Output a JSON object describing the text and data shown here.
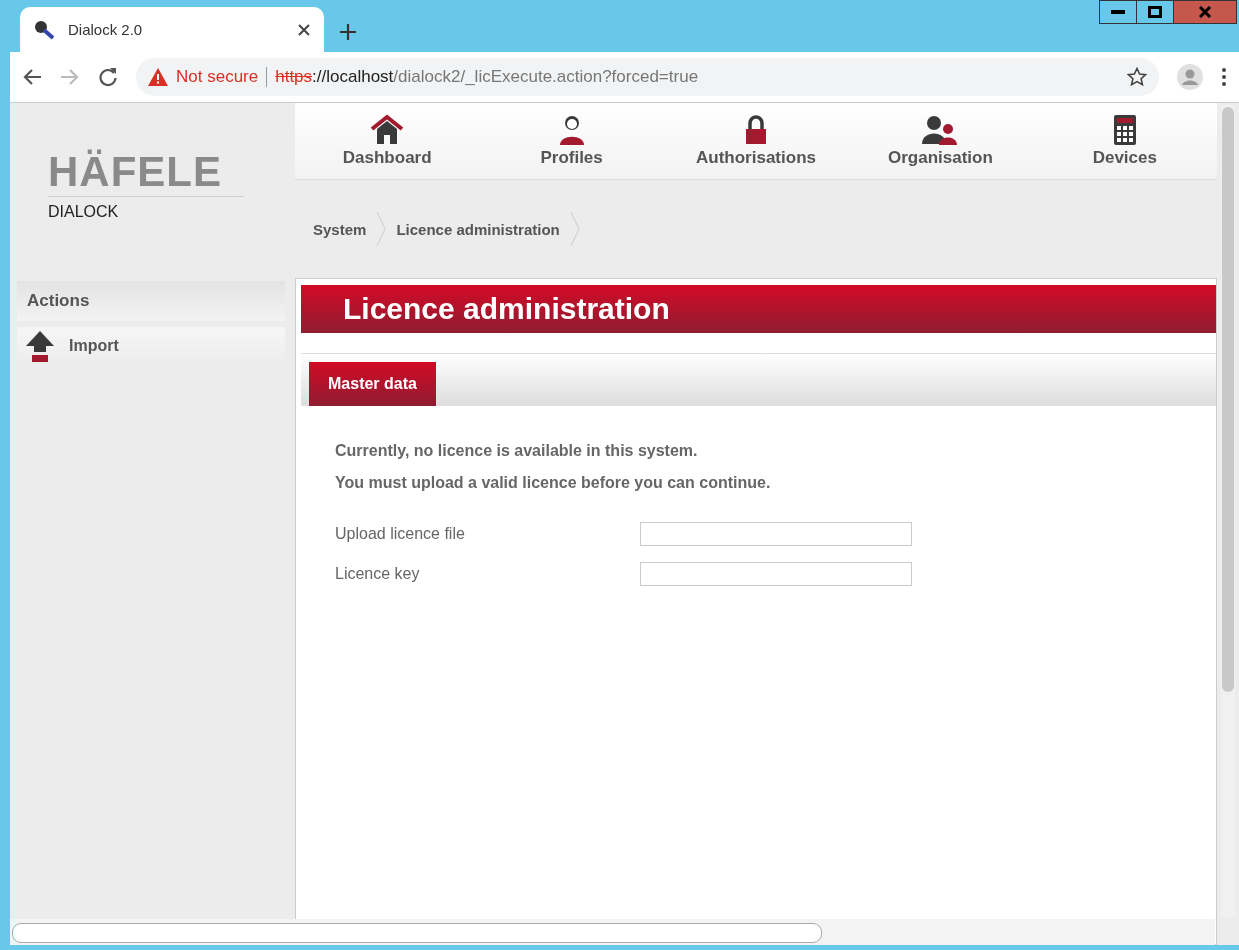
{
  "browser": {
    "tab_title": "Dialock 2.0",
    "security": "Not secure",
    "url_scheme": "https",
    "url_host": "://localhost",
    "url_path": "/dialock2/_licExecute.action?forced=true"
  },
  "logo": {
    "brand": "HÄFELE",
    "product": "DIALOCK"
  },
  "nav": [
    {
      "label": "Dashboard",
      "kind": "home"
    },
    {
      "label": "Profiles",
      "kind": "person"
    },
    {
      "label": "Authorisations",
      "kind": "lock"
    },
    {
      "label": "Organisation",
      "kind": "people"
    },
    {
      "label": "Devices",
      "kind": "device"
    }
  ],
  "breadcrumb": [
    "System",
    "Licence administration"
  ],
  "actions": {
    "title": "Actions",
    "items": [
      "Import"
    ]
  },
  "page_title": "Licence administration",
  "tabs": [
    {
      "label": "Master data",
      "selected": true
    }
  ],
  "messages": [
    "Currently, no licence is available in this system.",
    "You must upload a valid licence before you can continue."
  ],
  "fields": [
    {
      "label": "Upload licence file"
    },
    {
      "label": "Licence key"
    }
  ]
}
